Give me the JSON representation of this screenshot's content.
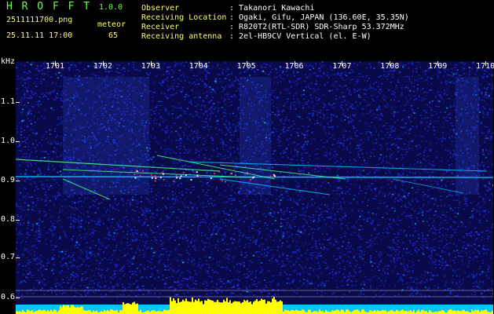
{
  "header": {
    "app_title": "H R O F F T",
    "version": "1.0.0",
    "filename": "2511111700.png",
    "mode": "meteor",
    "datetime": "25.11.11 17:00",
    "count": "65",
    "fields": [
      {
        "label": "Observer",
        "value": ": Takanori Kawachi"
      },
      {
        "label": "Receiving Location",
        "value": ": Ogaki, Gifu, JAPAN (136.60E, 35.35N)"
      },
      {
        "label": "Receiver",
        "value": ": R820T2(RTL-SDR) SDR-Sharp 53.372MHz"
      },
      {
        "label": "Receiving antenna",
        "value": ": 2el-HB9CV Vertical (el. E-W)"
      }
    ]
  },
  "y_axis": {
    "unit": "kHz",
    "ticks": [
      "1.1",
      "1.0",
      "0.9",
      "0.8",
      "0.7",
      "0.6"
    ]
  },
  "x_axis": {
    "ticks": [
      "1701",
      "1702",
      "1703",
      "1704",
      "1705",
      "1706",
      "1707",
      "1708",
      "1709",
      "1710"
    ]
  },
  "colors": {
    "background": "#0a0a4a",
    "noise_blue": "#1a2ad0",
    "noise_cyan": "#00c8ff",
    "trace_green": "#40ff80",
    "trace_red": "#ff3060",
    "signal_bar": "#ffff00",
    "signal_base": "#00c8ff",
    "header_green": "#66ff44",
    "header_yellow": "#ffff66"
  }
}
